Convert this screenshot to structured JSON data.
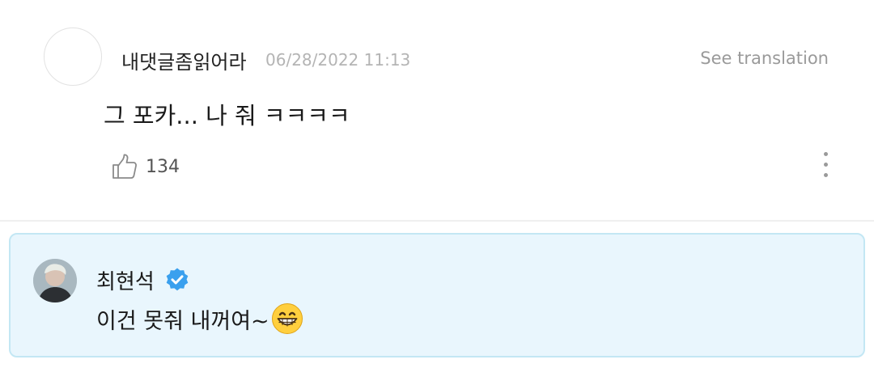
{
  "comment": {
    "username": "내댓글좀읽어라",
    "timestamp": "06/28/2022 11:13",
    "translate_label": "See translation",
    "text": "그 포카... 나 줘 ㅋㅋㅋㅋ",
    "like_count": "134"
  },
  "reply": {
    "author": "최현석",
    "text": "이건 못줘 내꺼여~",
    "emoji": "grinning-face-with-smiling-eyes"
  },
  "colors": {
    "reply_background": "#e9f6fd",
    "reply_border": "#c3e7f4",
    "verified_badge": "#3aa0ee",
    "muted_text": "#9a9a9a"
  }
}
